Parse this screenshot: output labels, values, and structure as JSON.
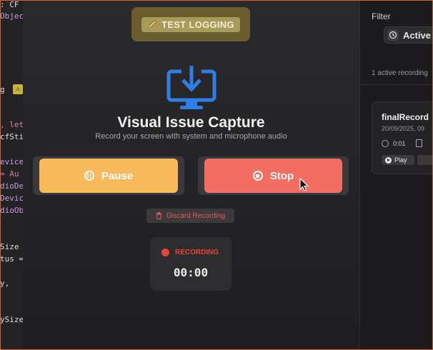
{
  "code_lines": [
    {
      "text": ": CF",
      "color": "#dddddd"
    },
    {
      "text": "Objec",
      "color": "#c79adf"
    },
    {
      "text": "g",
      "color": "#dddddd"
    },
    {
      "text": ", let",
      "color": "#e07aa0"
    },
    {
      "text": "cfSti",
      "color": "#dddddd"
    },
    {
      "text": "evice",
      "color": "#c79adf"
    },
    {
      "text": "= Au",
      "color": "#e07aa0"
    },
    {
      "text": "dioDe",
      "color": "#c79adf"
    },
    {
      "text": "Devic",
      "color": "#c79adf"
    },
    {
      "text": "dioObj",
      "color": "#c79adf"
    },
    {
      "text": "Size",
      "color": "#dddddd"
    },
    {
      "text": "tus =",
      "color": "#dddddd"
    },
    {
      "text": "y,",
      "color": "#dddddd"
    },
    {
      "text": "ySize",
      "color": "#dddddd"
    }
  ],
  "test_logging": {
    "label": "TEST LOGGING"
  },
  "header": {
    "title": "Visual Issue Capture",
    "subtitle": "Record your screen with system and microphone audio"
  },
  "controls": {
    "pause_label": "Pause",
    "stop_label": "Stop",
    "discard_label": "Discard Recording"
  },
  "status": {
    "label": "RECORDING",
    "time": "00:00"
  },
  "sidebar": {
    "filter_label": "Filter",
    "active_tab_label": "Active",
    "count_text": "1 active recording",
    "recording": {
      "name": "finalRecord",
      "date": "20/09/2025, 09",
      "duration": "0:01",
      "play_label": "Play"
    }
  },
  "colors": {
    "accent_blue": "#2f7ee8",
    "pause": "#f7b95a",
    "stop": "#f26d62",
    "recording_red": "#e8443a"
  }
}
